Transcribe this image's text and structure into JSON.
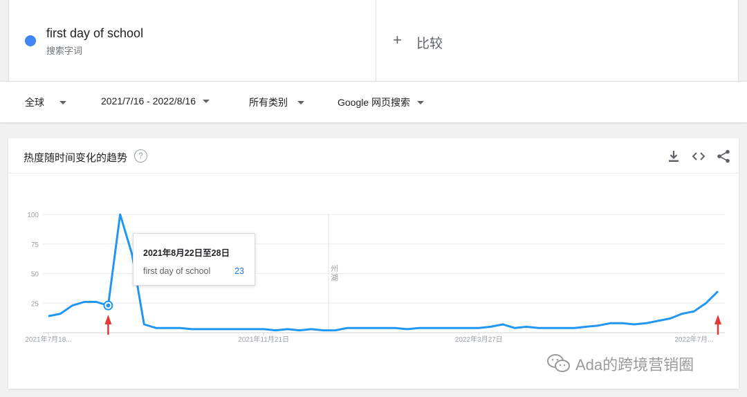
{
  "search_term": {
    "name": "first day of school",
    "type_label": "搜索字词",
    "color": "#4285f4"
  },
  "compare": {
    "plus": "+",
    "label": "比较"
  },
  "filters": {
    "region": "全球",
    "date_range": "2021/7/16 - 2022/8/16",
    "category": "所有类别",
    "property": "Google 网页搜索"
  },
  "card": {
    "title": "热度随时间变化的趋势",
    "help": "?"
  },
  "tooltip": {
    "date": "2021年8月22日至28日",
    "term": "first day of school",
    "value": "23"
  },
  "annotation_note": "州\n湖",
  "watermark": "Ada的跨境营销圈",
  "chart_data": {
    "type": "line",
    "y_ticks": [
      "100",
      "75",
      "50",
      "25"
    ],
    "ylim": [
      0,
      100
    ],
    "x_tick_labels": [
      "2021年7月18...",
      "2021年11月21日",
      "2022年3月27日",
      "2022年7月..."
    ],
    "x_tick_index": [
      0,
      18,
      36,
      54
    ],
    "series": [
      {
        "name": "first day of school",
        "color": "#2196f3",
        "values": [
          14,
          16,
          23,
          26,
          26,
          23,
          100,
          66,
          7,
          4,
          4,
          4,
          3,
          3,
          3,
          3,
          3,
          3,
          3,
          2,
          3,
          2,
          3,
          2,
          2,
          4,
          4,
          4,
          4,
          4,
          3,
          4,
          4,
          4,
          4,
          4,
          4,
          5,
          7,
          4,
          5,
          4,
          4,
          4,
          4,
          5,
          6,
          8,
          8,
          7,
          8,
          10,
          12,
          16,
          18,
          25,
          35
        ]
      }
    ],
    "highlight_index": 5,
    "arrow_indices": [
      5,
      56
    ]
  }
}
